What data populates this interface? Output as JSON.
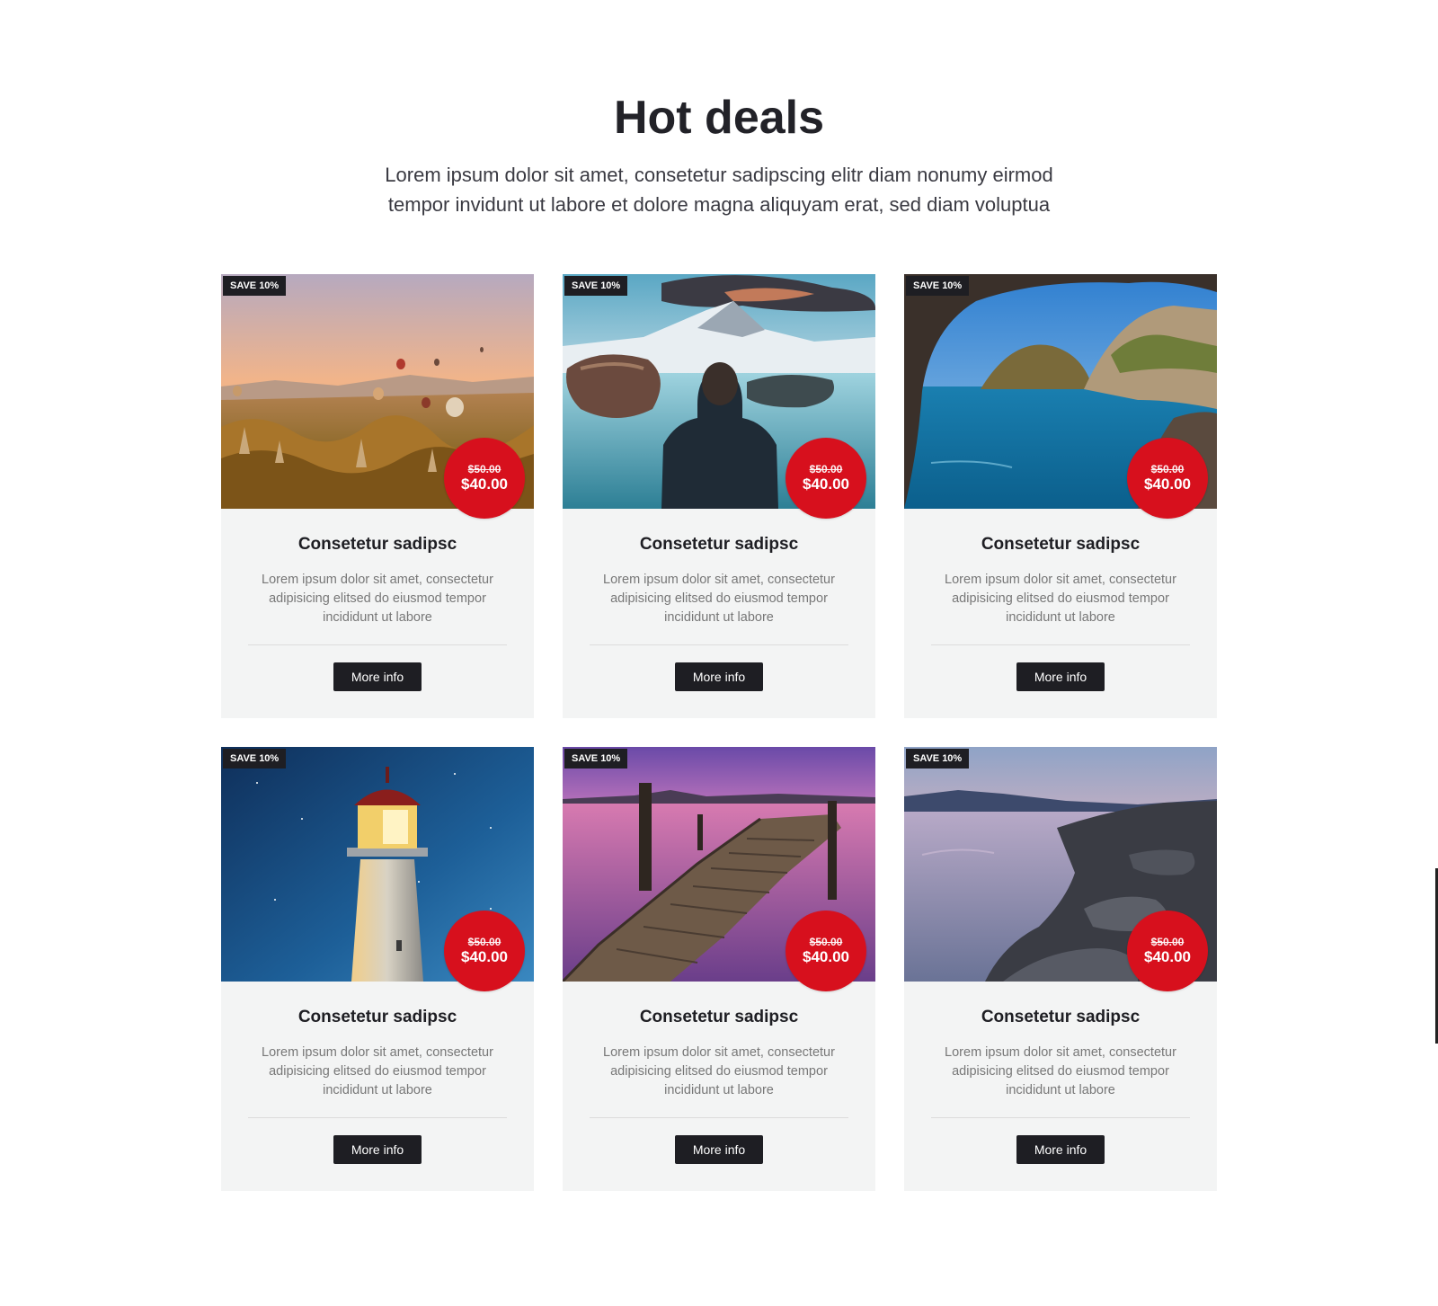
{
  "section": {
    "title": "Hot deals",
    "subtitle": "Lorem ipsum dolor sit amet, consetetur sadipscing elitr diam nonumy eirmod tempor invidunt ut labore et dolore magna aliquyam erat, sed diam voluptua"
  },
  "colors": {
    "accent_red": "#d7101d",
    "dark": "#1e1e23",
    "card_bg": "#f3f4f4"
  },
  "cards": [
    {
      "scene": "hot-air-balloons-valley",
      "badge": "SAVE 10%",
      "old_price": "$50.00",
      "new_price": "$40.00",
      "title": "Consetetur sadipsc",
      "text": "Lorem ipsum dolor sit amet, consectetur adipisicing elitsed do eiusmod tempor incididunt ut labore",
      "button": "More info"
    },
    {
      "scene": "man-by-mountain-lake",
      "badge": "SAVE 10%",
      "old_price": "$50.00",
      "new_price": "$40.00",
      "title": "Consetetur sadipsc",
      "text": "Lorem ipsum dolor sit amet, consectetur adipisicing elitsed do eiusmod tempor incididunt ut labore",
      "button": "More info"
    },
    {
      "scene": "sea-cave-view",
      "badge": "SAVE 10%",
      "old_price": "$50.00",
      "new_price": "$40.00",
      "title": "Consetetur sadipsc",
      "text": "Lorem ipsum dolor sit amet, consectetur adipisicing elitsed do eiusmod tempor incididunt ut labore",
      "button": "More info"
    },
    {
      "scene": "lighthouse-night",
      "badge": "SAVE 10%",
      "old_price": "$50.00",
      "new_price": "$40.00",
      "title": "Consetetur sadipsc",
      "text": "Lorem ipsum dolor sit amet, consectetur adipisicing elitsed do eiusmod tempor incididunt ut labore",
      "button": "More info"
    },
    {
      "scene": "pier-pink-sunset",
      "badge": "SAVE 10%",
      "old_price": "$50.00",
      "new_price": "$40.00",
      "title": "Consetetur sadipsc",
      "text": "Lorem ipsum dolor sit amet, consectetur adipisicing elitsed do eiusmod tempor incididunt ut labore",
      "button": "More info"
    },
    {
      "scene": "rocky-coast-dusk",
      "badge": "SAVE 10%",
      "old_price": "$50.00",
      "new_price": "$40.00",
      "title": "Consetetur sadipsc",
      "text": "Lorem ipsum dolor sit amet, consectetur adipisicing elitsed do eiusmod tempor incididunt ut labore",
      "button": "More info"
    }
  ]
}
